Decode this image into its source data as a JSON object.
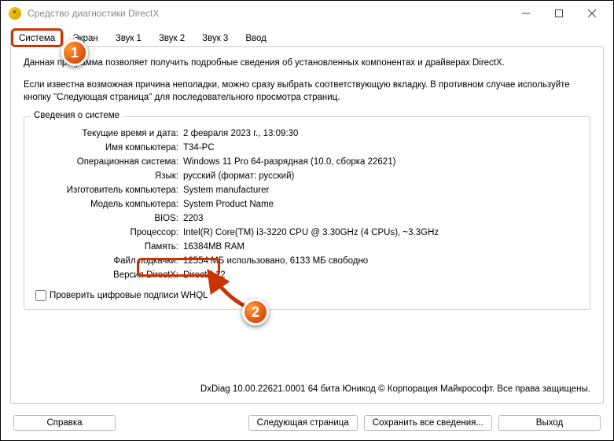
{
  "window": {
    "title": "Средство диагностики DirectX"
  },
  "tabs": {
    "items": [
      {
        "label": "Система"
      },
      {
        "label": "Экран"
      },
      {
        "label": "Звук 1"
      },
      {
        "label": "Звук 2"
      },
      {
        "label": "Звук 3"
      },
      {
        "label": "Ввод"
      }
    ]
  },
  "intro": {
    "p1": "Данная программа позволяет получить подробные сведения об установленных компонентах и драйверах DirectX.",
    "p2": "Если известна возможная причина неполадки, можно сразу выбрать соответствующую вкладку. В противном случае используйте кнопку \"Следующая страница\" для последовательного просмотра страниц."
  },
  "systemInfo": {
    "legend": "Сведения о системе",
    "rows": [
      {
        "label": "Текущие время и дата:",
        "value": "2 февраля 2023 г., 13:09:30"
      },
      {
        "label": "Имя компьютера:",
        "value": "T34-PC"
      },
      {
        "label": "Операционная система:",
        "value": "Windows 11 Pro 64-разрядная (10.0, сборка 22621)"
      },
      {
        "label": "Язык:",
        "value": "русский (формат: русский)"
      },
      {
        "label": "Изготовитель компьютера:",
        "value": "System manufacturer"
      },
      {
        "label": "Модель компьютера:",
        "value": "System Product Name"
      },
      {
        "label": "BIOS:",
        "value": "2203"
      },
      {
        "label": "Процессор:",
        "value": "Intel(R) Core(TM) i3-3220 CPU @ 3.30GHz (4 CPUs), ~3.3GHz"
      },
      {
        "label": "Память:",
        "value": "16384MB RAM"
      },
      {
        "label": "Файл подкачки:",
        "value": "12554 МБ использовано, 6133 МБ свободно"
      },
      {
        "label": "Версия DirectX:",
        "value": "DirectX 12"
      }
    ],
    "whql": "Проверить цифровые подписи WHQL"
  },
  "footer": "DxDiag 10.00.22621.0001 64 бита Юникод © Корпорация Майкрософт. Все права защищены.",
  "buttons": {
    "help": "Справка",
    "next": "Следующая страница",
    "save": "Сохранить все сведения...",
    "exit": "Выход"
  },
  "markers": {
    "m1": "1",
    "m2": "2"
  }
}
